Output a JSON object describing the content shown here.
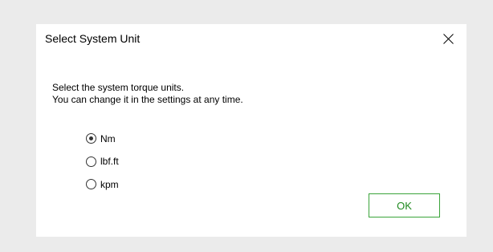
{
  "dialog": {
    "title": "Select System Unit",
    "close_icon": "close-icon",
    "message_line1": "Select the system torque units.",
    "message_line2": "You can change it in the settings at any time.",
    "options": [
      {
        "label": "Nm",
        "checked": true
      },
      {
        "label": "lbf.ft",
        "checked": false
      },
      {
        "label": "kpm",
        "checked": false
      }
    ],
    "ok_label": "OK",
    "ok_border_color": "#3aa43a"
  }
}
